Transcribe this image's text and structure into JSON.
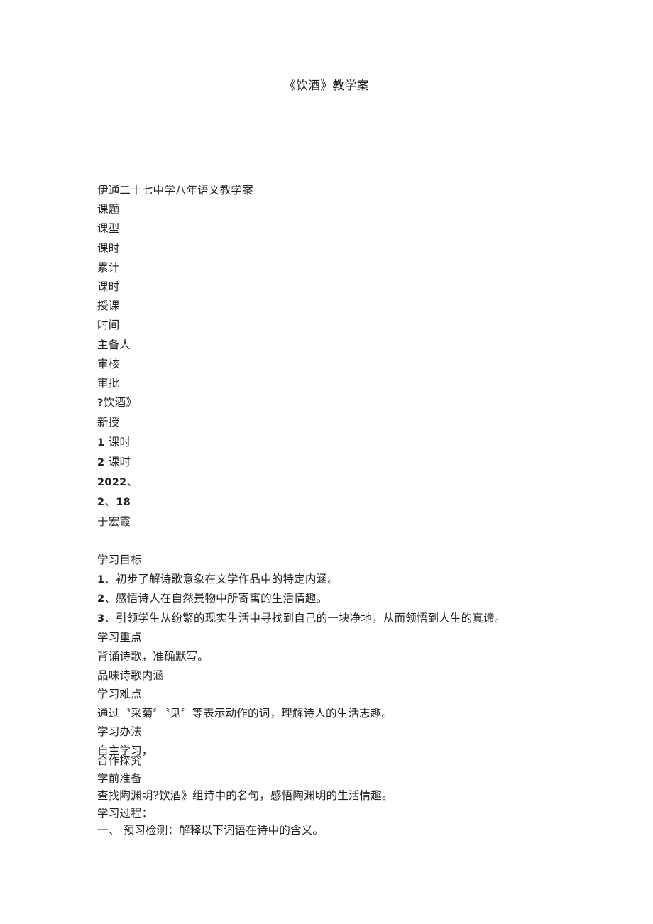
{
  "document": {
    "title": "《饮酒》教学案",
    "meta_block": [
      {
        "text": "伊通二十七中学八年语文教学案",
        "style": "normal"
      },
      {
        "text": "课题",
        "style": "normal"
      },
      {
        "text": "课型",
        "style": "normal"
      },
      {
        "text": "课时",
        "style": "normal"
      },
      {
        "text": "累计",
        "style": "normal"
      },
      {
        "text": "课时",
        "style": "normal"
      },
      {
        "text": "授课",
        "style": "normal"
      },
      {
        "text": "时间",
        "style": "normal"
      },
      {
        "text": "主备人",
        "style": "normal"
      },
      {
        "text": "审核",
        "style": "normal"
      },
      {
        "text": "审批",
        "style": "normal"
      },
      {
        "text": "?饮酒》",
        "style": "alt"
      },
      {
        "text": "新授",
        "style": "normal"
      },
      {
        "text": "1 课时",
        "style": "alt"
      },
      {
        "text": "2 课时",
        "style": "alt"
      },
      {
        "text": "2022、",
        "style": "alt"
      },
      {
        "text": "2、18",
        "style": "alt"
      },
      {
        "text": "于宏霞",
        "style": "normal"
      }
    ],
    "objectives_block": [
      {
        "text": "学习目标",
        "style": "normal"
      },
      {
        "text": "1、初步了解诗歌意象在文学作品中的特定内涵。",
        "style": "numbered"
      },
      {
        "text": "2、感悟诗人在自然景物中所寄寓的生活情趣。",
        "style": "numbered"
      },
      {
        "text": "3、引领学生从纷繁的现实生活中寻找到自己的一块净地，从而领悟到人生的真谛。",
        "style": "numbered"
      },
      {
        "text": "学习重点",
        "style": "normal"
      },
      {
        "text": "背诵诗歌，准确默写。",
        "style": "normal"
      },
      {
        "text": "品味诗歌内涵",
        "style": "normal"
      },
      {
        "text": "学习难点",
        "style": "normal"
      },
      {
        "text": "通过〝采菊〞〝见〞等表示动作的词，理解诗人的生活志趣。",
        "style": "normal"
      },
      {
        "text": "学习办法",
        "style": "normal"
      },
      {
        "text": "自主学习，",
        "style": "normal"
      }
    ],
    "process_block": [
      {
        "text": "合作探究",
        "style": "normal"
      },
      {
        "text": "学前准备",
        "style": "normal"
      },
      {
        "text": "查找陶渊明?饮酒》组诗中的名句，感悟陶渊明的生活情趣。",
        "style": "normal"
      },
      {
        "text": "学习过程：",
        "style": "normal"
      },
      {
        "text": "一、 预习检测：解释以下词语在诗中的含义。",
        "style": "normal"
      }
    ]
  }
}
